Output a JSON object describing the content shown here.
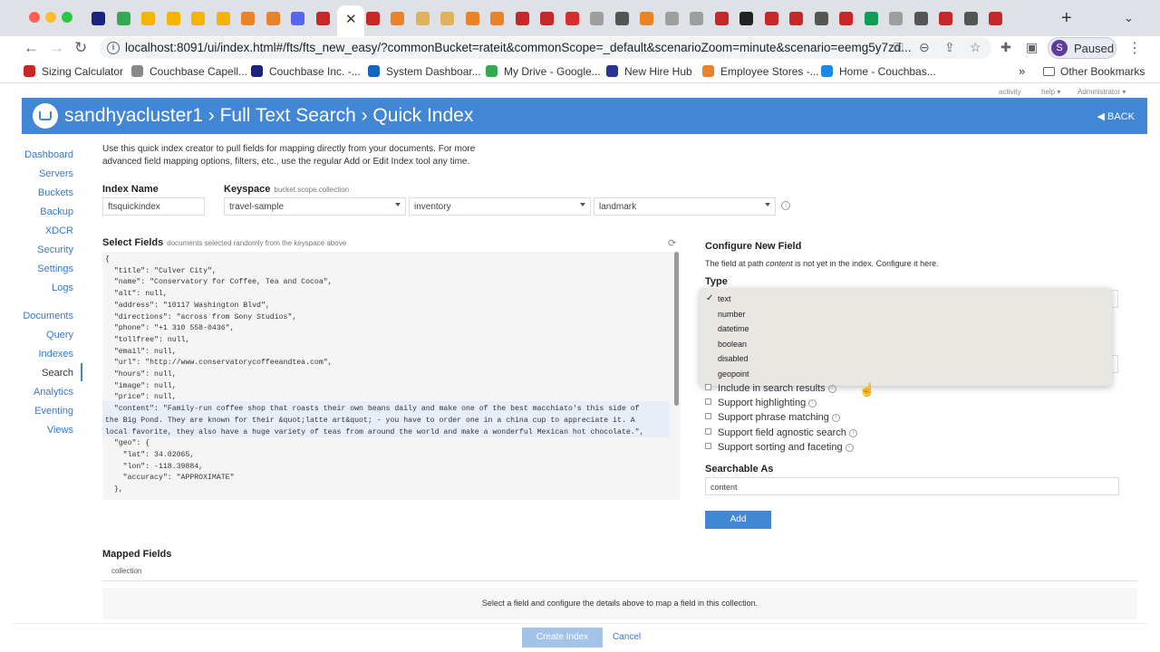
{
  "browser": {
    "url": "localhost:8091/ui/index.html#/fts/fts_new_easy/?commonBucket=rateit&commonScope=_default&scenarioZoom=minute&scenario=eemg5y7zd...",
    "profile_initial": "S",
    "profile_status": "Paused",
    "tab_icon_colors": [
      "#1a237e",
      "#34a853",
      "#f4b400",
      "#f4b400",
      "#f4b400",
      "#f4b400",
      "#e8832a",
      "#e8832a",
      "#5865f2",
      "#c62828",
      "#c62828",
      "#c62828",
      "#e8832a",
      "#e0b25c",
      "#e0b25c",
      "#e8832a",
      "#e8832a",
      "#c62828",
      "#c62828",
      "#d32f2f",
      "#9e9e9e",
      "#555555",
      "#e8832a",
      "#9e9e9e",
      "#9e9e9e",
      "#c62828",
      "#222222",
      "#c62828",
      "#c62828",
      "#555555",
      "#c62828",
      "#0f9d58",
      "#9e9e9e",
      "#555555",
      "#c62828",
      "#555555",
      "#c62828"
    ],
    "bookmarks": [
      {
        "label": "Sizing Calculator",
        "color": "#c62828"
      },
      {
        "label": "Couchbase Capell...",
        "color": "#888888"
      },
      {
        "label": "Couchbase Inc. -...",
        "color": "#1a237e"
      },
      {
        "label": "System Dashboar...",
        "color": "#1565c0"
      },
      {
        "label": "My Drive - Google...",
        "color": "#34a853"
      },
      {
        "label": "New Hire Hub",
        "color": "#283593"
      },
      {
        "label": "Employee Stores -...",
        "color": "#e8832a"
      },
      {
        "label": "Home - Couchbas...",
        "color": "#1e88e5"
      }
    ],
    "bookmarks_more": "»",
    "other_bookmarks": "Other Bookmarks"
  },
  "app": {
    "meta_activity": "activity",
    "meta_help": "help ▾",
    "meta_admin": "Administrator ▾",
    "breadcrumb": "sandhyacluster1 › Full Text Search › Quick Index",
    "back_label": "BACK",
    "accent_color": "#4287d6",
    "sidenav": [
      "Dashboard",
      "Servers",
      "Buckets",
      "Backup",
      "XDCR",
      "Security",
      "Settings",
      "Logs",
      "Documents",
      "Query",
      "Indexes",
      "Search",
      "Analytics",
      "Eventing",
      "Views"
    ],
    "sidenav_active": "Search",
    "intro": "Use this quick index creator to pull fields for mapping directly from your documents. For more advanced field mapping options, filters, etc., use the regular Add or Edit Index tool any time.",
    "index_name_label": "Index Name",
    "index_name_value": "ftsquickindex",
    "keyspace_label": "Keyspace",
    "keyspace_hint": "bucket.scope.collection",
    "bucket": "travel-sample",
    "scope": "inventory",
    "collection": "landmark",
    "select_fields_label": "Select Fields",
    "select_fields_hint": "documents selected randomly from the keyspace above",
    "json_lines": [
      "{",
      "  \"title\": \"Culver City\",",
      "  \"name\": \"Conservatory for Coffee, Tea and Cocoa\",",
      "  \"alt\": null,",
      "  \"address\": \"10117 Washington Blvd\",",
      "  \"directions\": \"across from Sony Studios\",",
      "  \"phone\": \"+1 310 558-0436\",",
      "  \"tollfree\": null,",
      "  \"email\": null,",
      "  \"url\": \"http://www.conservatorycoffeeandtea.com\",",
      "  \"hours\": null,",
      "  \"image\": null,",
      "  \"price\": null,",
      "  \"content\": \"Family-run coffee shop that roasts their own beans daily and make one of the best macchiato's this side of",
      "the Big Pond. They are known for their &quot;latte art&quot; - you have to order one in a china cup to appreciate it. A",
      "local favorite, they also have a huge variety of teas from around the world and make a wonderful Mexican hot chocolate.\",",
      "  \"geo\": {",
      "    \"lat\": 34.02065,",
      "    \"lon\": -118.39884,",
      "    \"accuracy\": \"APPROXIMATE\"",
      "  },"
    ],
    "configure_title": "Configure New Field",
    "configure_desc_pre": "The field at path ",
    "configure_desc_path": "content",
    "configure_desc_post": " is not yet in the index. Configure it here.",
    "type_label": "Type",
    "type_options": [
      "text",
      "number",
      "datetime",
      "boolean",
      "disabled",
      "geopoint"
    ],
    "type_selected": "text",
    "checkboxes": [
      "Include in search results",
      "Support highlighting",
      "Support phrase matching",
      "Support field agnostic search",
      "Support sorting and faceting"
    ],
    "searchable_as_label": "Searchable As",
    "searchable_as_value": "content",
    "add_label": "Add",
    "mapped_fields_label": "Mapped Fields",
    "mapped_fields_tab": "collection",
    "mapped_fields_empty": "Select a field and configure the details above to map a field in this collection.",
    "create_index_label": "Create Index",
    "cancel_label": "Cancel"
  }
}
